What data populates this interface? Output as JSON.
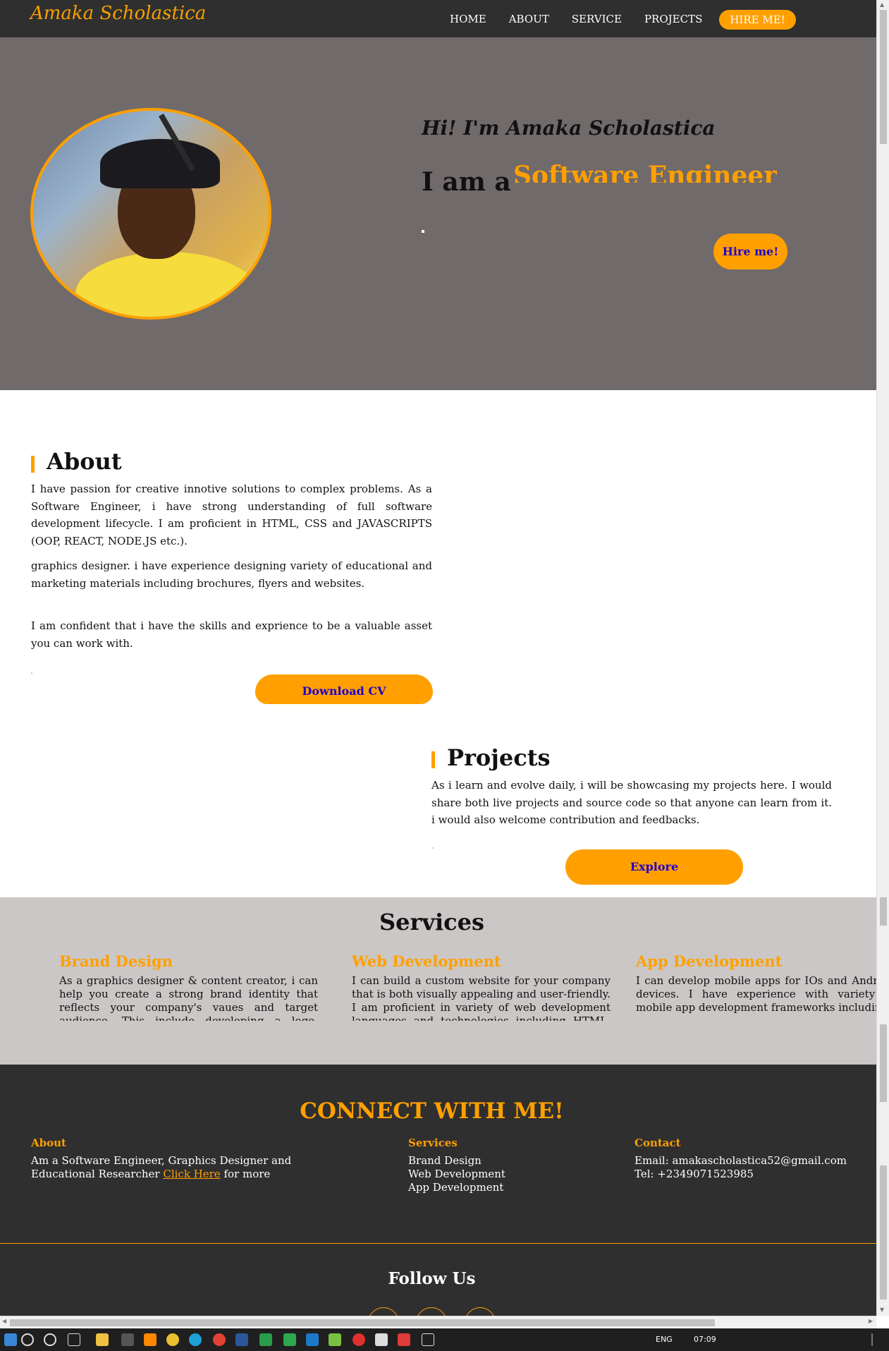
{
  "nav": {
    "brand": "Amaka Scholastica",
    "links": [
      "HOME",
      "ABOUT",
      "SERVICE",
      "PROJECTS"
    ],
    "hire": "HIRE ME!"
  },
  "hero": {
    "greeting": "Hi! I'm Amaka Scholastica",
    "iam": "I am a",
    "role": "Software Engineer",
    "hire_button": "Hire me!"
  },
  "about": {
    "title": "About",
    "p1": "I have passion for creative innotive solutions to complex problems. As a Software Engineer, i have strong understanding of full software development lifecycle. I am proficient in HTML, CSS and JAVASCRIPTS (OOP, REACT, NODE.JS etc.).",
    "p2": "graphics designer. i have experience designing variety of educational and marketing materials including brochures, flyers and websites.",
    "p3": "I am confident that i have the skills and exprience to be a valuable asset you can work with.",
    "button": "Download CV"
  },
  "projects": {
    "title": "Projects",
    "text": "As i learn and evolve daily, i will be showcasing my projects here. I would share both live projects and source code so that anyone can learn from it. i would also welcome contribution and feedbacks.",
    "button": "Explore"
  },
  "services": {
    "title": "Services",
    "items": [
      {
        "title": "Brand Design",
        "text": "As a graphics designer & content creator, i can help you create a strong brand identity that reflects your company's vaues and target audience. This include developing a logo, tagline, color schemes and"
      },
      {
        "title": "Web Development",
        "text": "I can build a custom website for your company that is both visually appealing and user-friendly. I am proficient in variety of web development languages and technologies including HTML, CSS"
      },
      {
        "title": "App Development",
        "text": "I can develop mobile apps for IOs and Android devices. I have experience with variety of mobile app development frameworks including"
      }
    ]
  },
  "footer": {
    "connect": "CONNECT WITH ME!",
    "about_heading": "About",
    "about_text_1": "Am a Software Engineer, Graphics Designer and",
    "about_text_2": "Educational Researcher",
    "about_link": "Click Here",
    "about_text_3": " for more",
    "services_heading": "Services",
    "services_items": [
      "Brand Design",
      "Web Development",
      "App Development"
    ],
    "contact_heading": "Contact",
    "email": "Email: amakascholastica52@gmail.com",
    "tel": "Tel: +2349071523985",
    "follow": "Follow Us"
  },
  "taskbar": {
    "lang": "ENG",
    "time": "07:09"
  },
  "colors": {
    "accent": "#ffa000",
    "nav_bg": "#2f2f2f",
    "hero_bg": "#716a6b",
    "services_bg": "#cbc7c6",
    "button_text": "#2200cc"
  }
}
